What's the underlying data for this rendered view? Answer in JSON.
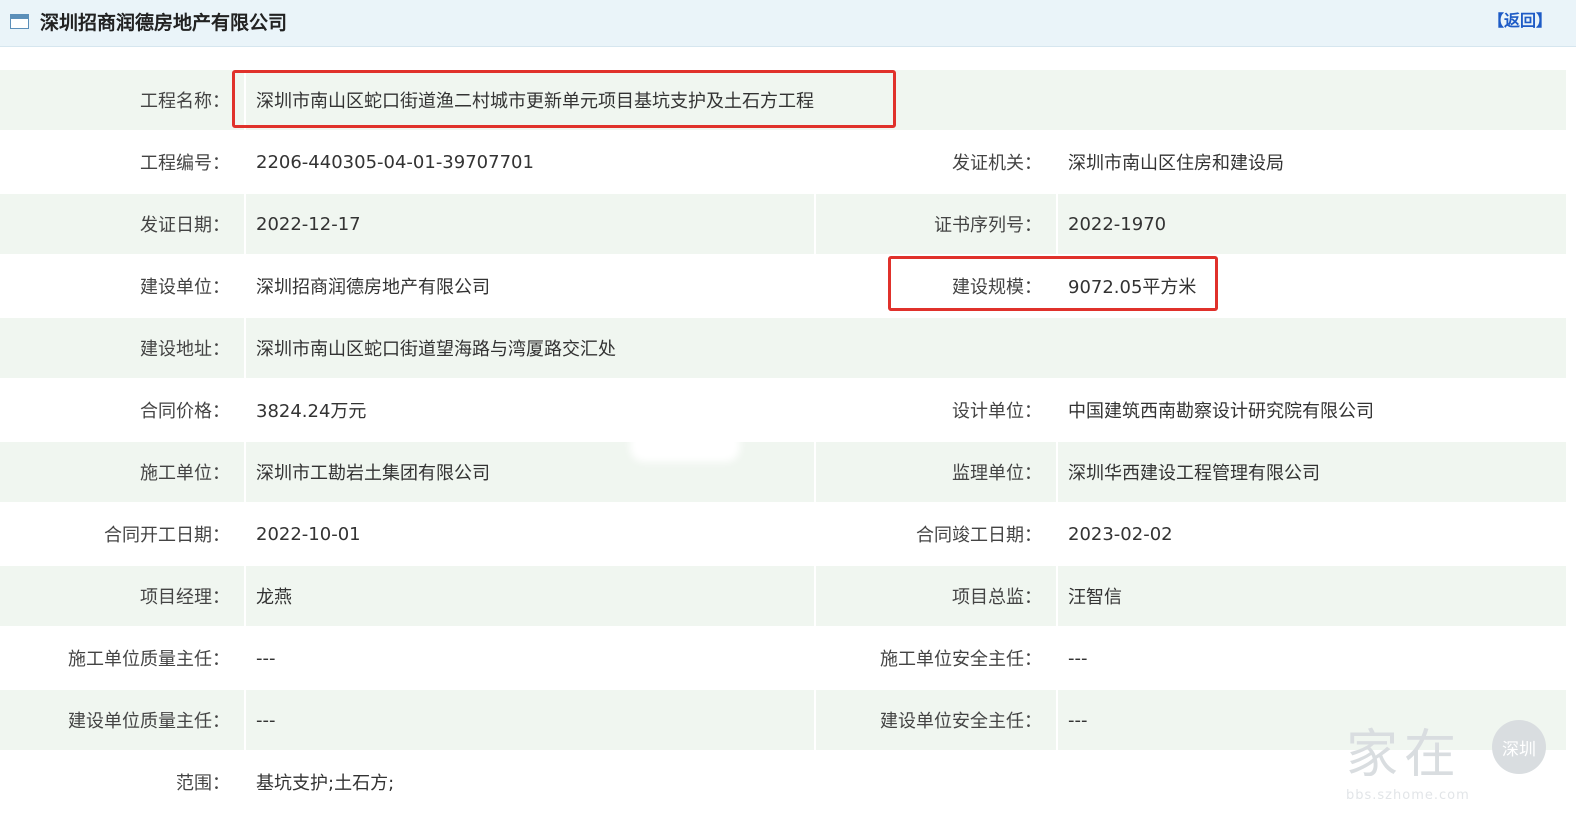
{
  "header": {
    "title": "深圳招商润德房地产有限公司",
    "back_label": "【返回】"
  },
  "rows": [
    {
      "l1": "工程名称：",
      "v1": "深圳市南山区蛇口街道渔二村城市更新单元项目基坑支护及土石方工程"
    },
    {
      "l1": "工程编号：",
      "v1": "2206-440305-04-01-39707701",
      "l2": "发证机关：",
      "v2": "深圳市南山区住房和建设局"
    },
    {
      "l1": "发证日期：",
      "v1": "2022-12-17",
      "l2": "证书序列号：",
      "v2": "2022-1970"
    },
    {
      "l1": "建设单位：",
      "v1": "深圳招商润德房地产有限公司",
      "l2": "建设规模：",
      "v2": "9072.05平方米"
    },
    {
      "l1": "建设地址：",
      "v1": "深圳市南山区蛇口街道望海路与湾厦路交汇处"
    },
    {
      "l1": "合同价格：",
      "v1": "3824.24万元",
      "l2": "设计单位：",
      "v2": "中国建筑西南勘察设计研究院有限公司"
    },
    {
      "l1": "施工单位：",
      "v1": "深圳市工勘岩土集团有限公司",
      "l2": "监理单位：",
      "v2": "深圳华西建设工程管理有限公司"
    },
    {
      "l1": "合同开工日期：",
      "v1": "2022-10-01",
      "l2": "合同竣工日期：",
      "v2": "2023-02-02"
    },
    {
      "l1": "项目经理：",
      "v1": "龙燕",
      "l2": "项目总监：",
      "v2": "汪智信"
    },
    {
      "l1": "施工单位质量主任：",
      "v1": "---",
      "l2": "施工单位安全主任：",
      "v2": "---"
    },
    {
      "l1": "建设单位质量主任：",
      "v1": "---",
      "l2": "建设单位安全主任：",
      "v2": "---"
    },
    {
      "l1": "范围：",
      "v1": "基坑支护;土石方;"
    }
  ],
  "watermark": {
    "text": "家在",
    "badge": "深圳",
    "url": "bbs.szhome.com"
  },
  "colors": {
    "header_bg": "#eaf4f9",
    "row_shade": "#f0f6f0",
    "highlight_box": "#e0312b",
    "link": "#1e5bc6"
  }
}
